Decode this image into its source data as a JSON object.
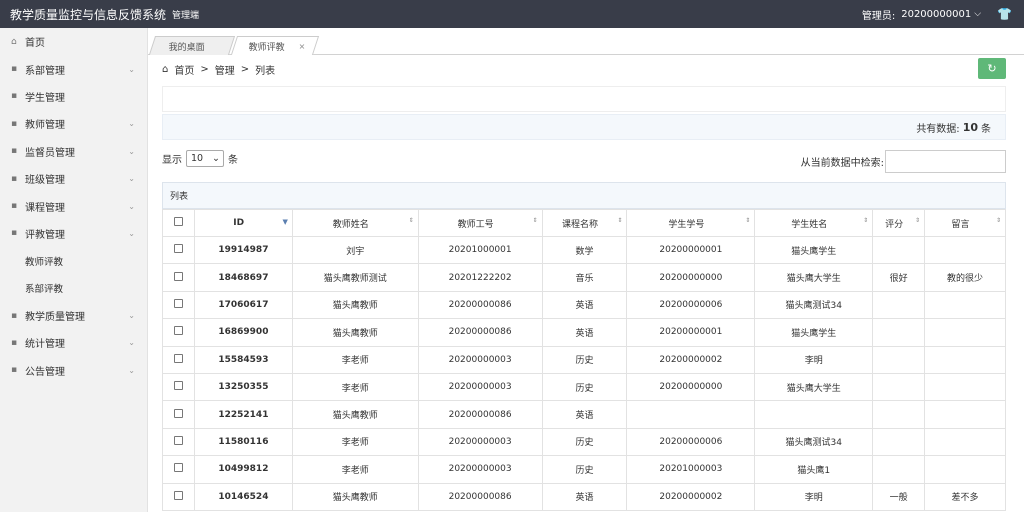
{
  "header": {
    "title": "教学质量监控与信息反馈系统",
    "subtitle": "管理端",
    "admin_label": "管理员:",
    "admin_id": "20200000001"
  },
  "sidebar": {
    "items": [
      {
        "label": "首页",
        "icon": "home-icon",
        "arrow": false
      },
      {
        "label": "系部管理",
        "icon": "dept-icon",
        "arrow": true
      },
      {
        "label": "学生管理",
        "icon": "user-icon",
        "arrow": false
      },
      {
        "label": "教师管理",
        "icon": "teacher-icon",
        "arrow": true
      },
      {
        "label": "监督员管理",
        "icon": "supervisor-icon",
        "arrow": true
      },
      {
        "label": "班级管理",
        "icon": "class-icon",
        "arrow": true
      },
      {
        "label": "课程管理",
        "icon": "course-icon",
        "arrow": true
      },
      {
        "label": "评教管理",
        "icon": "eval-icon",
        "arrow": true
      },
      {
        "label": "教师评教",
        "sub": true
      },
      {
        "label": "系部评教",
        "sub": true
      },
      {
        "label": "教学质量管理",
        "icon": "quality-icon",
        "arrow": true
      },
      {
        "label": "统计管理",
        "icon": "stats-icon",
        "arrow": true
      },
      {
        "label": "公告管理",
        "icon": "notice-icon",
        "arrow": true
      }
    ]
  },
  "tabs": [
    {
      "label": "我的桌面"
    },
    {
      "label": "教师评教",
      "close": "×"
    }
  ],
  "breadcrumb": {
    "items": [
      "首页",
      "管理",
      "列表"
    ],
    "sep": ">"
  },
  "summary": {
    "prefix": "共有数据:",
    "count": "10",
    "suffix": "条"
  },
  "length": {
    "show_label": "显示",
    "value": "10",
    "unit": "条"
  },
  "search": {
    "label": "从当前数据中检索:"
  },
  "table": {
    "caption": "列表",
    "headers": [
      "ID",
      "教师姓名",
      "教师工号",
      "课程名称",
      "学生学号",
      "学生姓名",
      "评分",
      "留言"
    ],
    "rows": [
      [
        "19914987",
        "刘宇",
        "20201000001",
        "数学",
        "20200000001",
        "猫头鹰学生",
        "",
        ""
      ],
      [
        "18468697",
        "猫头鹰教师测试",
        "20201222202",
        "音乐",
        "20200000000",
        "猫头鹰大学生",
        "很好",
        "教的很少"
      ],
      [
        "17060617",
        "猫头鹰教师",
        "20200000086",
        "英语",
        "20200000006",
        "猫头鹰测试34",
        "",
        ""
      ],
      [
        "16869900",
        "猫头鹰教师",
        "20200000086",
        "英语",
        "20200000001",
        "猫头鹰学生",
        "",
        ""
      ],
      [
        "15584593",
        "李老师",
        "20200000003",
        "历史",
        "20200000002",
        "李明",
        "",
        ""
      ],
      [
        "13250355",
        "李老师",
        "20200000003",
        "历史",
        "20200000000",
        "猫头鹰大学生",
        "",
        ""
      ],
      [
        "12252141",
        "猫头鹰教师",
        "20200000086",
        "英语",
        "",
        "",
        "",
        ""
      ],
      [
        "11580116",
        "李老师",
        "20200000003",
        "历史",
        "20200000006",
        "猫头鹰测试34",
        "",
        ""
      ],
      [
        "10499812",
        "李老师",
        "20200000003",
        "历史",
        "20201000003",
        "猫头鹰1",
        "",
        ""
      ],
      [
        "10146524",
        "猫头鹰教师",
        "20200000086",
        "英语",
        "20200000002",
        "李明",
        "一般",
        "差不多"
      ]
    ]
  },
  "colors": {
    "topbar": "#393d49",
    "refresh_button": "#5fb878",
    "sidebar_bg": "#f2f2f2"
  }
}
